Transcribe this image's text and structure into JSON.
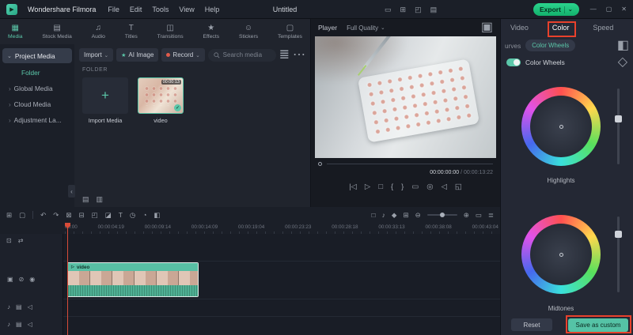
{
  "colors": {
    "accent": "#5bc7a9",
    "export_green": "#1fc97d",
    "annotation_red": "#e8412c"
  },
  "menubar": {
    "app_name": "Wondershare Filmora",
    "menus": [
      "File",
      "Edit",
      "Tools",
      "View",
      "Help"
    ],
    "project_title": "Untitled",
    "export_label": "Export"
  },
  "media_panel": {
    "tabs": [
      {
        "label": "Media"
      },
      {
        "label": "Stock Media"
      },
      {
        "label": "Audio"
      },
      {
        "label": "Titles"
      },
      {
        "label": "Transitions"
      },
      {
        "label": "Effects"
      },
      {
        "label": "Stickers"
      },
      {
        "label": "Templates"
      }
    ],
    "active_tab": "Media",
    "sidebar": {
      "project_media": "Project Media",
      "folder": "Folder",
      "items": [
        "Global Media",
        "Cloud Media",
        "Adjustment La..."
      ]
    },
    "toolbar": {
      "import_label": "Import",
      "ai_image_label": "AI Image",
      "record_label": "Record",
      "search_placeholder": "Search media"
    },
    "folder_heading": "FOLDER",
    "tiles": [
      {
        "label": "Import Media"
      },
      {
        "label": "video",
        "duration_badge": "00:00:13"
      }
    ]
  },
  "player": {
    "label": "Player",
    "quality": "Full Quality",
    "current_time": "00:00:00:00",
    "separator": " / ",
    "duration": "00:00:13:22"
  },
  "color_panel": {
    "tabs": [
      "Video",
      "Color",
      "Speed"
    ],
    "active_tab": "Color",
    "curves_label": "urves",
    "wheels_pill_label": "Color Wheels",
    "toggle_label": "Color Wheels",
    "wheels": [
      {
        "label": "Highlights"
      },
      {
        "label": "Midtones"
      }
    ],
    "reset_label": "Reset",
    "save_label": "Save as custom"
  },
  "timeline": {
    "ruler": [
      "00:00",
      "00:00:04:19",
      "00:00:09:14",
      "00:00:14:09",
      "00:00:19:04",
      "00:00:23:23",
      "00:00:28:18",
      "00:00:33:13",
      "00:00:38:08",
      "00:00:43:04"
    ],
    "clip": {
      "name": "video"
    }
  },
  "icons": {
    "logo": "▶",
    "chevron_down": "⌄",
    "chevron_right": "›",
    "minimize": "—",
    "maximize": "▢",
    "close": "✕",
    "mb1": "▭",
    "mb2": "⊞",
    "mb3": "◰",
    "mb4": "▤",
    "media": "▦",
    "stock": "▤",
    "audio": "♫",
    "titles": "T",
    "transitions": "◫",
    "effects": "★",
    "stickers": "☺",
    "templates": "▢",
    "sparkle": "★",
    "filter": "≣",
    "more": "⋯",
    "plus": "+",
    "check": "✓",
    "folder_new": "▤",
    "folder_open": "▥",
    "collapse": "‹",
    "fit_view": "▣",
    "prev_frame": "|◁",
    "play": "▷",
    "stop": "□",
    "mark_in": "{",
    "mark_out": "}",
    "crop": "▭",
    "snapshot": "◎",
    "volume": "◁",
    "fullscreen": "◱",
    "compare": "◧",
    "keyframe_diamond": "◇",
    "tl": [
      "⊞",
      "▢",
      "↶",
      "↷",
      "⊠",
      "⊟",
      "◰",
      "◪",
      "T",
      "◷",
      "◔",
      "◧"
    ],
    "tlr": [
      "□",
      "♪",
      "◆",
      "⊞"
    ],
    "zoom_out": "⊖",
    "zoom_in": "⊕",
    "fit": "▭",
    "list": "≣",
    "track_video": "▣",
    "track_lock": "⊘",
    "track_eye": "◉",
    "track_note": "♪",
    "track_folder": "▤",
    "track_mute": "◁",
    "corner1": "⊡",
    "corner2": "⇄"
  }
}
